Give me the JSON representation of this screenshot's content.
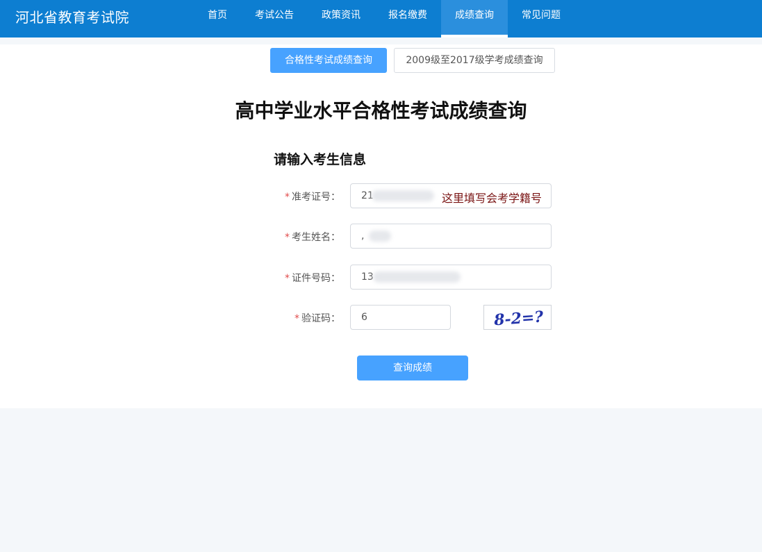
{
  "header": {
    "brand": "河北省教育考试院",
    "nav": [
      {
        "label": "首页"
      },
      {
        "label": "考试公告"
      },
      {
        "label": "政策资讯"
      },
      {
        "label": "报名缴费"
      },
      {
        "label": "成绩查询",
        "active": true
      },
      {
        "label": "常见问题"
      }
    ]
  },
  "tabs": [
    {
      "label": "合格性考试成绩查询",
      "active": true
    },
    {
      "label": "2009级至2017级学考成绩查询",
      "active": false
    }
  ],
  "page_title": "高中学业水平合格性考试成绩查询",
  "section_title": "请输入考生信息",
  "form": {
    "required_mark": "*",
    "exam_id": {
      "label": "准考证号：",
      "value": "21"
    },
    "name": {
      "label": "考生姓名：",
      "value": ","
    },
    "id_number": {
      "label": "证件号码：",
      "value": "13"
    },
    "captcha": {
      "label": "验证码：",
      "value": "6",
      "image_text": "8-2=?"
    }
  },
  "annotation": "这里填写会考学籍号",
  "submit_label": "查询成绩",
  "colors": {
    "nav_bg": "#0d7ed1",
    "primary": "#47a2ff",
    "required": "#e14b4b",
    "annotation": "#7a1414"
  }
}
